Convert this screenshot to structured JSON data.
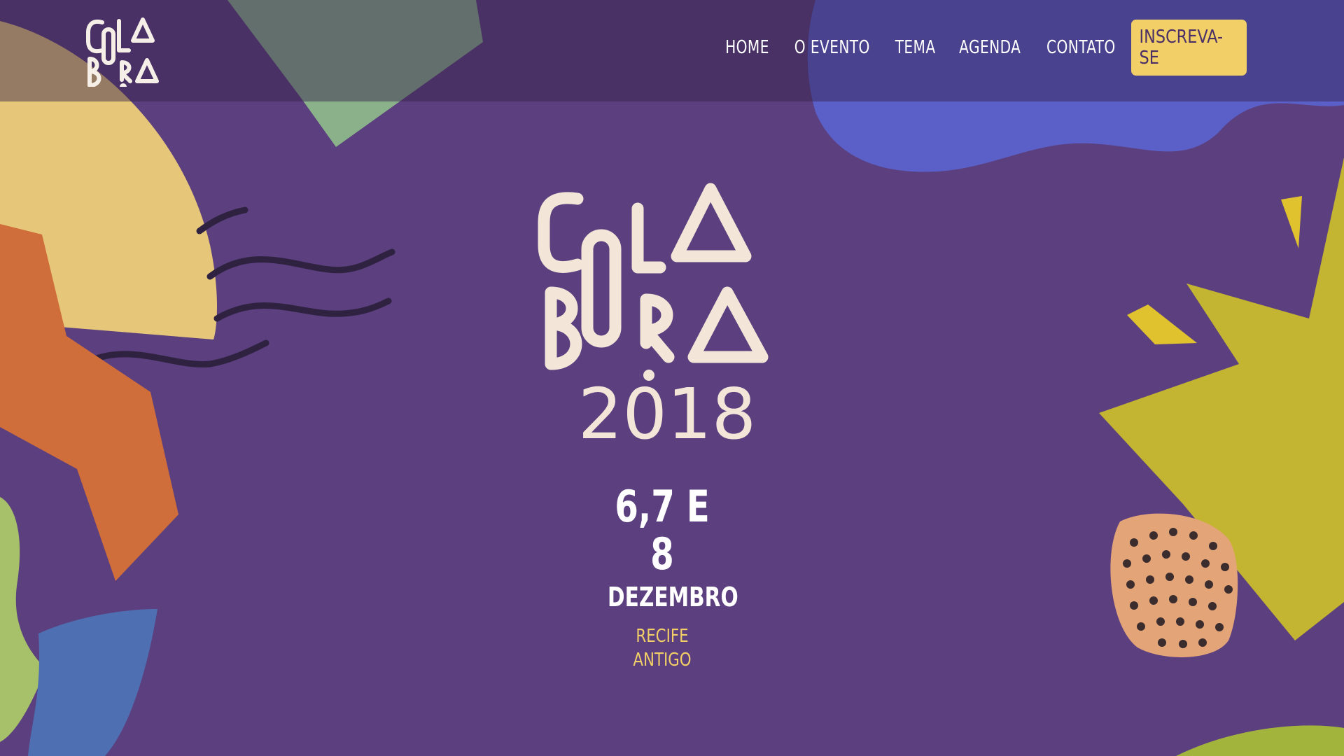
{
  "brand": {
    "logo_lines": [
      "COLA",
      "BORA"
    ],
    "logo_year": "2018"
  },
  "nav": {
    "items": [
      "HOME",
      "O EVENTO",
      "TEMA",
      "AGENDA",
      "CONTATO"
    ],
    "cta": "INSCREVA-SE"
  },
  "hero": {
    "dates": "6,7 E 8",
    "month": "DEZEMBRO",
    "location": "RECIFE ANTIGO"
  },
  "colors": {
    "background": "#5b3f7e",
    "accent_yellow": "#f2cf67",
    "logo_cream": "#f3e6d8"
  }
}
